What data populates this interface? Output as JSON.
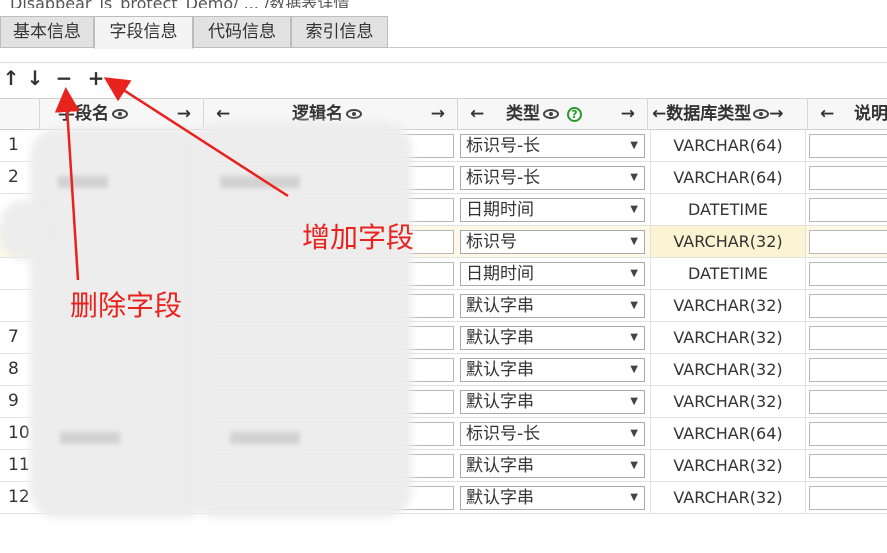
{
  "title": "Disappear_is_protect_Demo/ ... /数据表详情",
  "tabs": [
    {
      "label": "基本信息"
    },
    {
      "label": "字段信息"
    },
    {
      "label": "代码信息"
    },
    {
      "label": "索引信息"
    }
  ],
  "toolbar": {
    "move_up": "↑",
    "move_down": "↓",
    "remove": "−",
    "add": "+"
  },
  "columns": {
    "field_name": "字段名",
    "logical_name": "逻辑名",
    "type": "类型",
    "db_type": "数据库类型",
    "description": "说明",
    "left_arrow": "←",
    "right_arrow": "→"
  },
  "rows": [
    {
      "num": "1",
      "type": "标识号-长",
      "db_type": "VARCHAR(64)"
    },
    {
      "num": "2",
      "type": "标识号-长",
      "db_type": "VARCHAR(64)"
    },
    {
      "num": "",
      "type": "日期时间",
      "db_type": "DATETIME"
    },
    {
      "num": "",
      "type": "标识号",
      "db_type": "VARCHAR(32)"
    },
    {
      "num": "",
      "type": "日期时间",
      "db_type": "DATETIME"
    },
    {
      "num": "",
      "type": "默认字串",
      "db_type": "VARCHAR(32)"
    },
    {
      "num": "7",
      "type": "默认字串",
      "db_type": "VARCHAR(32)"
    },
    {
      "num": "8",
      "type": "默认字串",
      "db_type": "VARCHAR(32)"
    },
    {
      "num": "9",
      "type": "默认字串",
      "db_type": "VARCHAR(32)"
    },
    {
      "num": "10",
      "type": "标识号-长",
      "db_type": "VARCHAR(64)"
    },
    {
      "num": "11",
      "type": "默认字串",
      "db_type": "VARCHAR(32)"
    },
    {
      "num": "12",
      "type": "默认字串",
      "db_type": "VARCHAR(32)"
    }
  ],
  "annotations": {
    "add_field": "增加字段",
    "delete_field": "删除字段"
  },
  "colors": {
    "annotation": "#e8231e",
    "highlight_row": "#fdf9e6",
    "help_icon": "#2a9a2a"
  }
}
